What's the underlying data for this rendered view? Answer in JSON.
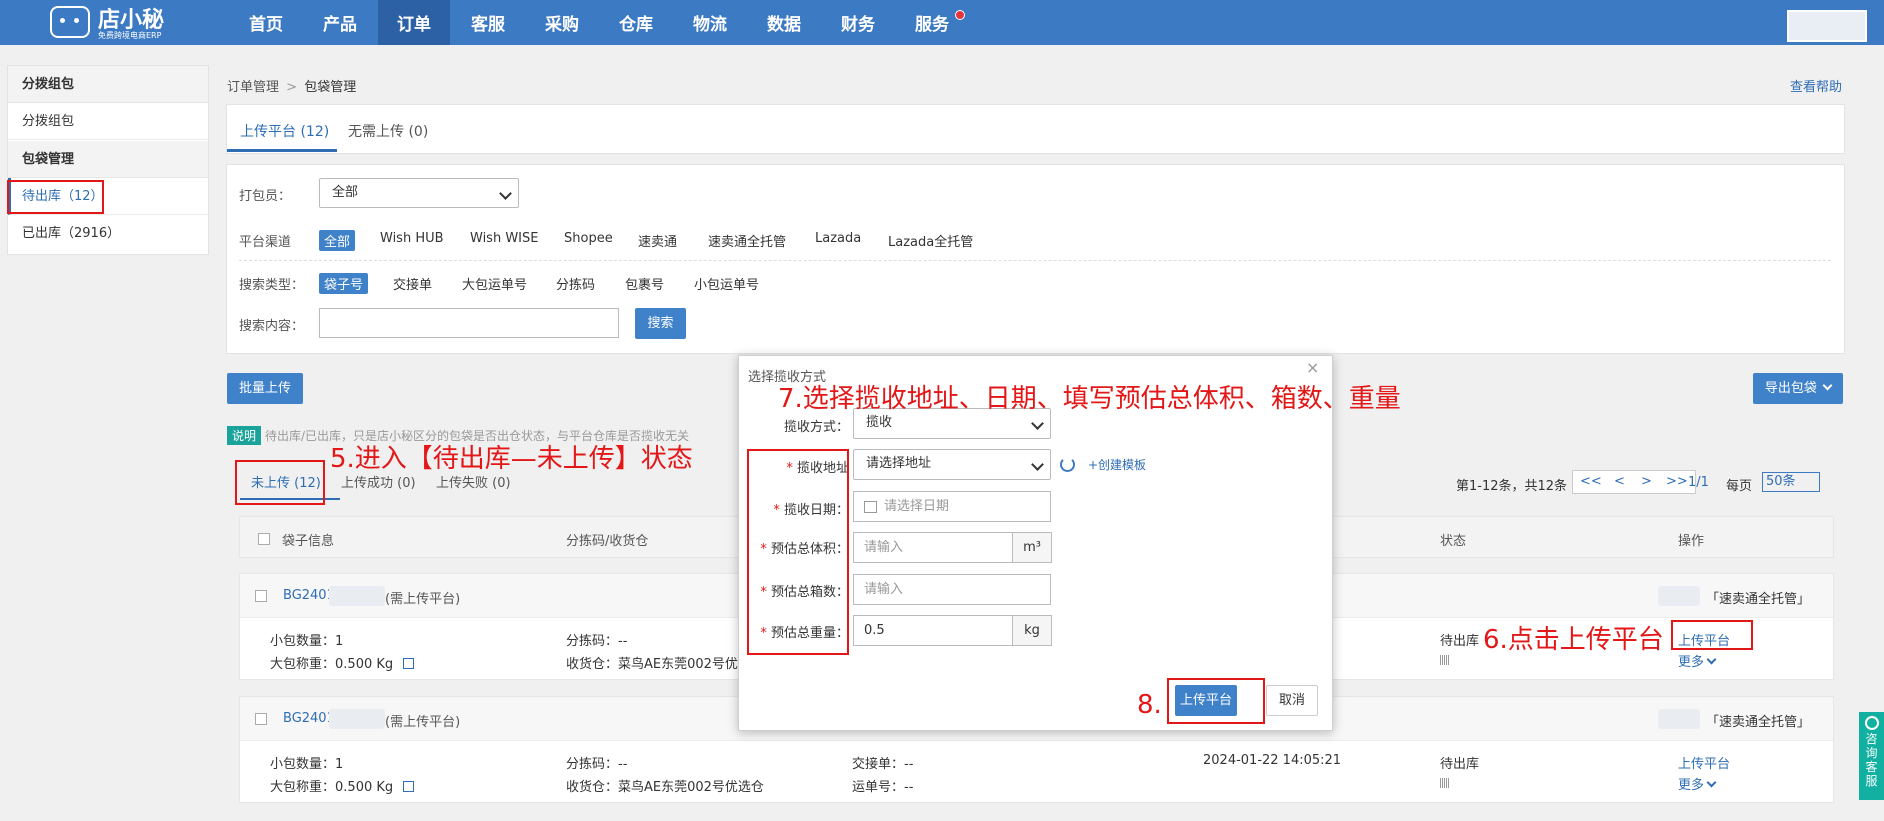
{
  "brand": {
    "name": "店小秘",
    "slogan": "免费跨境电商ERP"
  },
  "nav": {
    "items": [
      "首页",
      "产品",
      "订单",
      "客服",
      "采购",
      "仓库",
      "物流",
      "数据",
      "财务",
      "服务"
    ],
    "active": "订单"
  },
  "sidebar": {
    "group1_title": "分拨组包",
    "group1_item": "分拨组包",
    "group2_title": "包袋管理",
    "item_pending": "待出库（12）",
    "item_shipped": "已出库（2916）"
  },
  "breadcrumb": {
    "parent": "订单管理",
    "sep": ">",
    "current": "包袋管理"
  },
  "help": "查看帮助",
  "top_tabs": {
    "upload": "上传平台 (12)",
    "no_upload": "无需上传 (0)"
  },
  "filters": {
    "packer_label": "打包员：",
    "packer_value": "全部",
    "channel_label": "平台渠道",
    "channels": [
      "全部",
      "Wish HUB",
      "Wish WISE",
      "Shopee",
      "速卖通",
      "速卖通全托管",
      "Lazada",
      "Lazada全托管"
    ],
    "search_type_label": "搜索类型：",
    "search_types": [
      "袋子号",
      "交接单",
      "大包运单号",
      "分拣码",
      "包裹号",
      "小包运单号"
    ],
    "search_content_label": "搜索内容：",
    "search_button": "搜索"
  },
  "actions": {
    "batch_upload": "批量上传",
    "export": "导出包袋"
  },
  "notice": {
    "badge": "说明",
    "text": "待出库/已出库，只是店小秘区分的包袋是否出仓状态，与平台仓库是否揽收无关"
  },
  "sub_tabs": {
    "not_uploaded": "未上传 (12)",
    "success": "上传成功 (0)",
    "failed": "上传失败 (0)"
  },
  "pagination": {
    "summary": "第1-12条，共12条",
    "first": "<<",
    "prev": "<",
    "next": ">",
    "last": ">>",
    "page": "1/1",
    "per_page_label": "每页",
    "per_page": "50条"
  },
  "table": {
    "headers": {
      "bag_info": "袋子信息",
      "sort_code": "分拣码/收货仓",
      "status": "状态",
      "ops": "操作"
    },
    "rows": [
      {
        "bag_no": "BG2401",
        "note": "(需上传平台)",
        "channel": "「速卖通全托管」",
        "qty_label": "小包数量：",
        "qty": "1",
        "weight_label": "大包称重：",
        "weight": "0.500 Kg",
        "sort_label": "分拣码：",
        "sort": "--",
        "wh_label": "收货仓：",
        "wh": "菜鸟AE东莞002号优选仓",
        "status": "待出库",
        "op_upload": "上传平台",
        "op_more": "更多"
      },
      {
        "bag_no": "BG2401",
        "note": "(需上传平台)",
        "channel": "「速卖通全托管」",
        "qty_label": "小包数量：",
        "qty": "1",
        "weight_label": "大包称重：",
        "weight": "0.500 Kg",
        "sort_label": "分拣码：",
        "sort": "--",
        "wh_label": "收货仓：",
        "wh": "菜鸟AE东莞002号优选仓",
        "handover_label": "交接单：",
        "handover": "--",
        "waybill_label": "运单号：",
        "waybill": "--",
        "time": "2024-01-22 14:05:21",
        "status": "待出库",
        "op_upload": "上传平台",
        "op_more": "更多"
      }
    ]
  },
  "modal": {
    "title": "选择揽收方式",
    "close": "×",
    "method_label": "揽收方式：",
    "method_value": "揽收",
    "address_label": "揽收地址",
    "address_placeholder": "请选择地址",
    "create_template": "+创建模板",
    "date_label": "揽收日期：",
    "date_placeholder": "请选择日期",
    "volume_label": "预估总体积：",
    "volume_placeholder": "请输入",
    "volume_unit": "m³",
    "boxes_label": "预估总箱数：",
    "boxes_placeholder": "请输入",
    "weight_label": "预估总重量：",
    "weight_value": "0.5",
    "weight_unit": "kg",
    "submit": "上传平台",
    "cancel": "取消"
  },
  "annotations": {
    "step5": "5.进入【待出库—未上传】状态",
    "step6": "6.点击上传平台",
    "step7": "7.选择揽收地址、日期、填写预估总体积、箱数、重量",
    "step8": "8."
  },
  "float_service": "咨询客服"
}
